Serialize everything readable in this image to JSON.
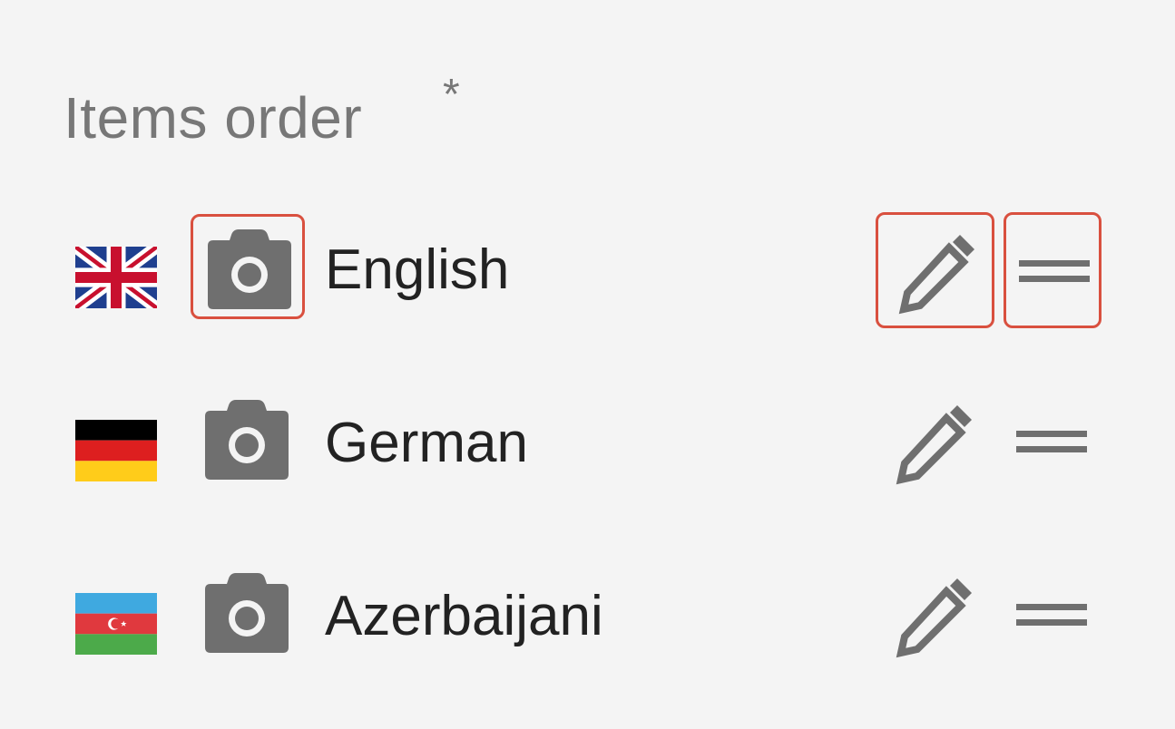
{
  "field": {
    "label": "Items order",
    "required_mark": "*"
  },
  "items": [
    {
      "label": "English",
      "flag": "uk-flag",
      "highlighted_controls": [
        "camera",
        "edit",
        "drag"
      ]
    },
    {
      "label": "German",
      "flag": "germany-flag",
      "highlighted_controls": []
    },
    {
      "label": "Azerbaijani",
      "flag": "azerbaijan-flag",
      "highlighted_controls": []
    }
  ],
  "icons": {
    "camera": "camera-icon",
    "edit": "pencil-icon",
    "drag": "drag-handle-icon"
  },
  "colors": {
    "background": "#f4f4f4",
    "label_text": "#777777",
    "item_text": "#222222",
    "icon": "#6f6f6f",
    "highlight_border": "#d9503f"
  }
}
